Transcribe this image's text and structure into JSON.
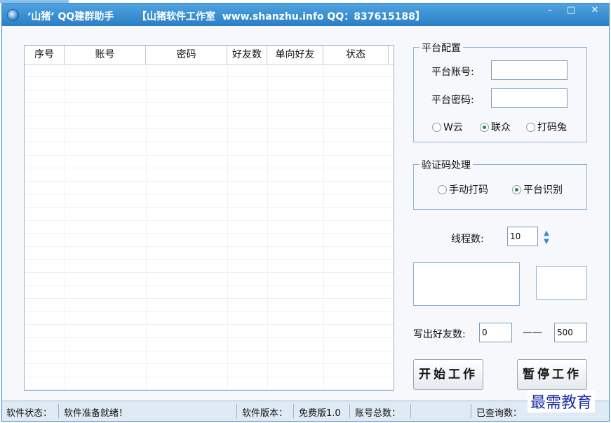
{
  "titlebar": {
    "title": "‘山猪’ QQ建群助手",
    "info": "【山猪软件工作室  www.shanzhu.info QQ：837615188】",
    "min": "–",
    "max": "□",
    "close": "✕"
  },
  "table": {
    "columns": [
      "序号",
      "账号",
      "密码",
      "好友数",
      "单向好友",
      "状态"
    ]
  },
  "platform": {
    "group_label": "平台配置",
    "account_label": "平台账号:",
    "account_value": "",
    "password_label": "平台密码:",
    "password_value": "",
    "options": [
      "W云",
      "联众",
      "打码兔"
    ],
    "selected": "联众"
  },
  "captcha": {
    "group_label": "验证码处理",
    "options": [
      "手动打码",
      "平台识别"
    ],
    "selected": "平台识别"
  },
  "threads": {
    "label": "线程数:",
    "value": "10"
  },
  "friends": {
    "label": "写出好友数:",
    "min_value": "0",
    "dash": "——",
    "max_value": "500"
  },
  "buttons": {
    "start": "开始工作",
    "pause": "暂停工作"
  },
  "statusbar": {
    "status_label": "软件状态：",
    "status_value": "软件准备就绪！",
    "version_label": "软件版本：",
    "version_value": "免费版1.0",
    "account_total_label": "账号总数：",
    "account_total_value": "",
    "queried_label": "已查询数："
  },
  "watermark": "最需教育"
}
